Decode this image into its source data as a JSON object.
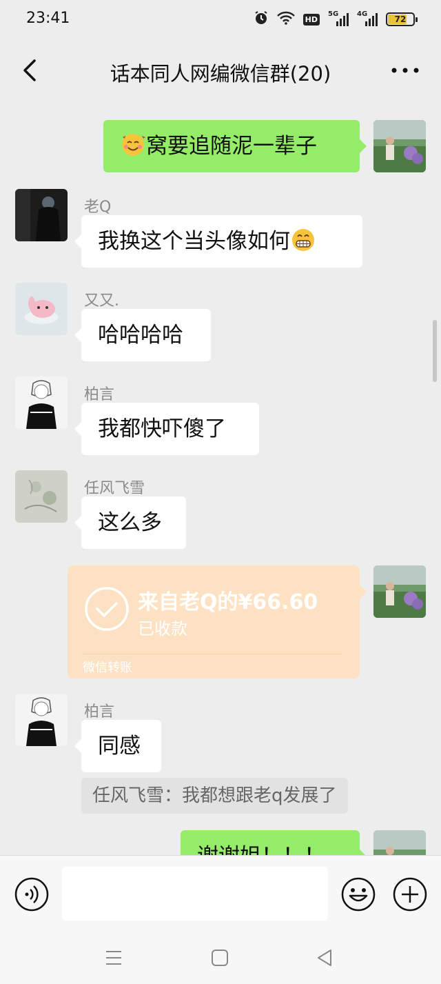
{
  "status_bar": {
    "time": "23:41",
    "hd_label": "HD",
    "signal1_label": "5G",
    "signal2_label": "4G",
    "battery": "72"
  },
  "nav": {
    "title": "话本同人网编微信群(20)",
    "back_icon": "chevron-left-icon",
    "more_icon": "more-dots-icon"
  },
  "messages": [
    {
      "direction": "out",
      "emoji": "smiling-face-with-hearts",
      "text": "窝要追随泥一辈子"
    },
    {
      "direction": "in",
      "sender": "老Q",
      "text": "我换这个当头像如何",
      "emoji": "grinning-face"
    },
    {
      "direction": "in",
      "sender": "又又.",
      "text": "哈哈哈哈"
    },
    {
      "direction": "in",
      "sender": "柏言",
      "text": "我都快吓傻了"
    },
    {
      "direction": "in",
      "sender": "任风飞雪",
      "text": "这么多"
    },
    {
      "direction": "in",
      "sender": "柏言",
      "text": "同感",
      "quote": "任风飞雪：我都想跟老q发展了"
    },
    {
      "direction": "out",
      "text": "谢谢姐！！！"
    }
  ],
  "transfer": {
    "amount_text": "来自老Q的¥66.60",
    "status": "已收款",
    "footer": "微信转账"
  },
  "input_bar": {
    "voice_icon": "voice-icon",
    "emoji_icon": "emoji-icon",
    "plus_icon": "plus-icon",
    "input_value": ""
  },
  "system_nav": [
    "menu-icon",
    "home-icon",
    "back-triangle-icon"
  ],
  "colors": {
    "out_bubble": "#95ec69",
    "in_bubble": "#ffffff",
    "transfer": "#fde1c3",
    "background": "#ededed"
  }
}
